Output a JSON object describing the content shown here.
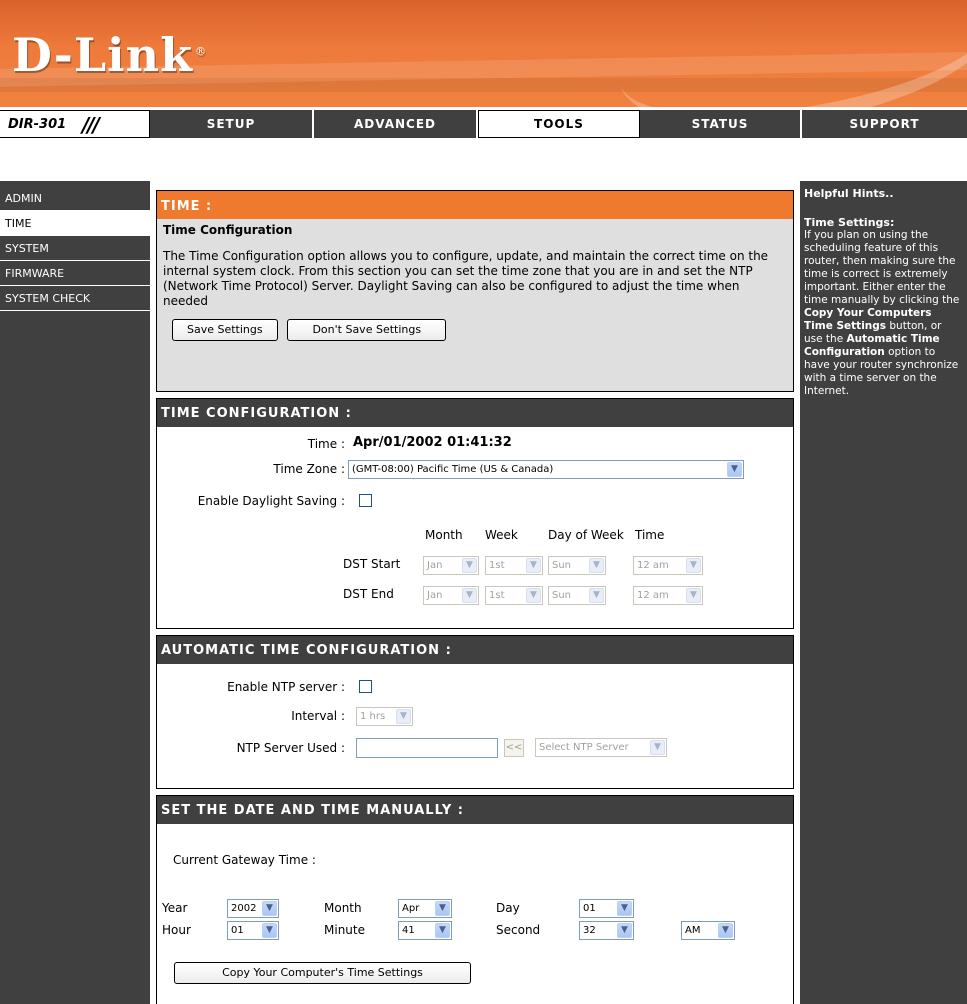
{
  "brand": {
    "logo": "D-Link",
    "model": "DIR-301"
  },
  "nav": {
    "tabs": [
      "SETUP",
      "ADVANCED",
      "TOOLS",
      "STATUS",
      "SUPPORT"
    ],
    "active": "TOOLS"
  },
  "sidebar": {
    "items": [
      "ADMIN",
      "TIME",
      "SYSTEM",
      "FIRMWARE",
      "SYSTEM CHECK"
    ],
    "active": "TIME"
  },
  "intro": {
    "heading": "TIME :",
    "subheading": "Time Configuration",
    "description": "The Time Configuration option allows you to configure, update, and maintain the correct time on the internal system clock. From this section you can set the time zone that you are in and set the NTP (Network Time Protocol) Server. Daylight Saving can also be configured to adjust the time when needed",
    "save_label": "Save Settings",
    "dont_save_label": "Don't Save Settings"
  },
  "time_config": {
    "heading": "TIME CONFIGURATION :",
    "time_label": "Time :",
    "time_value": "Apr/01/2002 01:41:32",
    "zone_label": "Time Zone :",
    "zone_value": "(GMT-08:00) Pacific Time (US & Canada)",
    "dst_label": "Enable Daylight Saving :",
    "col_month": "Month",
    "col_week": "Week",
    "col_dow": "Day of Week",
    "col_time": "Time",
    "dst_start_label": "DST Start",
    "dst_end_label": "DST End",
    "dst_start": {
      "month": "Jan",
      "week": "1st",
      "day": "Sun",
      "time": "12 am"
    },
    "dst_end": {
      "month": "Jan",
      "week": "1st",
      "day": "Sun",
      "time": "12 am"
    }
  },
  "auto_time": {
    "heading": "AUTOMATIC TIME CONFIGURATION :",
    "ntp_enable_label": "Enable NTP server :",
    "interval_label": "Interval :",
    "interval_value": "1 hrs",
    "ntp_server_label": "NTP Server Used :",
    "ntp_server_value": "",
    "copy_arrow": "<<",
    "select_ntp_label": "Select NTP Server"
  },
  "manual": {
    "heading": "SET THE DATE AND TIME MANUALLY :",
    "gateway_label": "Current Gateway Time :",
    "year_label": "Year",
    "year_value": "2002",
    "month_label": "Month",
    "month_value": "Apr",
    "day_label": "Day",
    "day_value": "01",
    "hour_label": "Hour",
    "hour_value": "01",
    "minute_label": "Minute",
    "minute_value": "41",
    "second_label": "Second",
    "second_value": "32",
    "ampm_value": "AM",
    "copy_button": "Copy Your Computer's Time Settings"
  },
  "hints": {
    "title": "Helpful Hints..",
    "subtitle": "Time Settings:",
    "text_1": "If you plan on using the scheduling feature of this router, then making sure the time is correct is extremely important. Either enter the time manually by clicking the ",
    "bold_1": "Copy Your Computers Time Settings",
    "text_2": " button, or use the ",
    "bold_2": "Automatic Time Configuration",
    "text_3": " option to have your router synchronize with a time server on the Internet."
  },
  "colors": {
    "orange": "#ef7a2e",
    "dark": "#404040",
    "intro_bg": "#dfdfdf"
  }
}
